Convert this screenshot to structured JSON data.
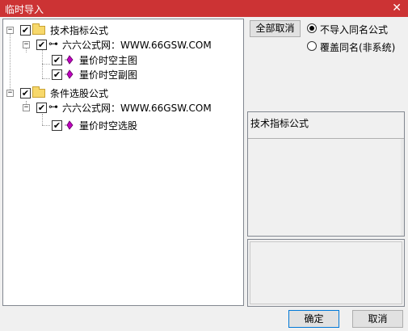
{
  "window": {
    "title": "临时导入",
    "close_glyph": "✕"
  },
  "tree": [
    {
      "id": "cat1",
      "label": "技术指标公式",
      "checked": true,
      "icon": "folder-icon"
    },
    {
      "id": "src1",
      "label": "六六公式网：WWW.66GSW.COM",
      "checked": true,
      "icon": "key-icon"
    },
    {
      "id": "f1",
      "label": "量价时空主图",
      "checked": true,
      "icon": "formula-icon"
    },
    {
      "id": "f2",
      "label": "量价时空副图",
      "checked": true,
      "icon": "formula-icon"
    },
    {
      "id": "cat2",
      "label": "条件选股公式",
      "checked": true,
      "icon": "folder-icon"
    },
    {
      "id": "src2",
      "label": "六六公式网：WWW.66GSW.COM",
      "checked": true,
      "icon": "key-icon"
    },
    {
      "id": "f3",
      "label": "量价时空选股",
      "checked": true,
      "icon": "formula-icon"
    }
  ],
  "controls": {
    "deselect_all_label": "全部取消",
    "radio_skip_label": "不导入同名公式",
    "radio_overwrite_label": "覆盖同名(非系统)",
    "selected_option": "不导入同名公式"
  },
  "info": {
    "title": "技术指标公式"
  },
  "footer": {
    "ok_label": "确定",
    "cancel_label": "取消"
  },
  "colors": {
    "titlebar": "#cc3334",
    "formula_icon": "#c000c0",
    "folder": "#f7d86b"
  }
}
